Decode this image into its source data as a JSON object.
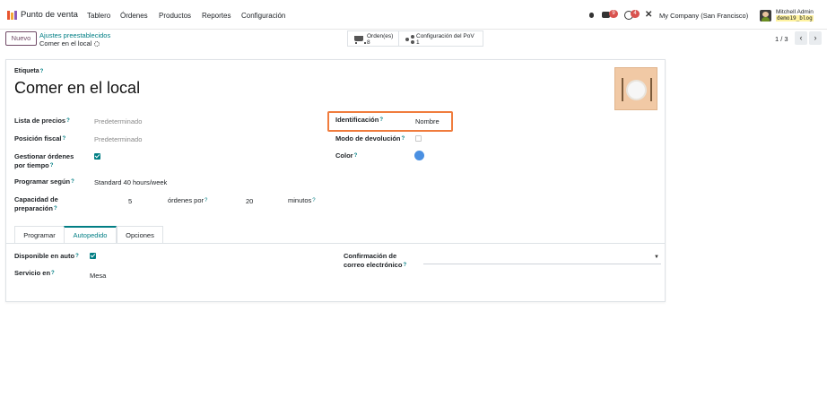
{
  "navbar": {
    "brand": "Punto de venta",
    "menu": [
      "Tablero",
      "Órdenes",
      "Productos",
      "Reportes",
      "Configuración"
    ],
    "chat_badge": "9",
    "activity_badge": "4",
    "company": "My Company (San Francisco)",
    "user_name": "Mitchell Admin",
    "user_db": "demo19_blog",
    "icons": [
      "apps-icon",
      "bug-icon",
      "chat-icon",
      "clock-icon",
      "tools-icon",
      "avatar"
    ]
  },
  "control": {
    "new_label": "Nuevo",
    "breadcrumb_parent": "Ajustes preestablecidos",
    "breadcrumb_current": "Comer en el local",
    "orders_label": "Orden(es)",
    "orders_count": "8",
    "pos_config_label": "Configuración del PoV",
    "pos_config_count": "1",
    "pager": "1 / 3",
    "prev": "‹",
    "next": "›"
  },
  "form": {
    "label_title": "Etiqueta",
    "name": "Comer en el local",
    "pricelist_label": "Lista de precios",
    "pricelist_placeholder": "Predeterminado",
    "fiscal_label": "Posición fiscal",
    "fiscal_placeholder": "Predeterminado",
    "manage_label_1": "Gestionar órdenes",
    "manage_label_2": "por tiempo",
    "manage_checked": true,
    "schedule_label": "Programar según",
    "schedule_value": "Standard 40 hours/week",
    "capacity_label_1": "Capacidad de",
    "capacity_label_2": "preparación",
    "capacity_value": "5",
    "orders_per_label": "órdenes por",
    "minutes_value": "20",
    "minutes_label": "minutos",
    "ident_label": "Identificación",
    "ident_value": "Nombre",
    "return_label": "Modo de devolución",
    "return_checked": false,
    "color_label": "Color",
    "color_value": "#4a90e2",
    "help_mark": "?"
  },
  "tabs": [
    "Programar",
    "Autopedido",
    "Opciones"
  ],
  "active_tab": "Autopedido",
  "selforder": {
    "available_label": "Disponible en auto",
    "available_checked": true,
    "service_label": "Servicio en",
    "service_value": "Mesa",
    "email_label_1": "Confirmación de",
    "email_label_2": "correo electrónico",
    "email_value": ""
  },
  "colors": {
    "accent": "#017e84",
    "brand": "#714b67",
    "highlight": "#f07c3d"
  }
}
